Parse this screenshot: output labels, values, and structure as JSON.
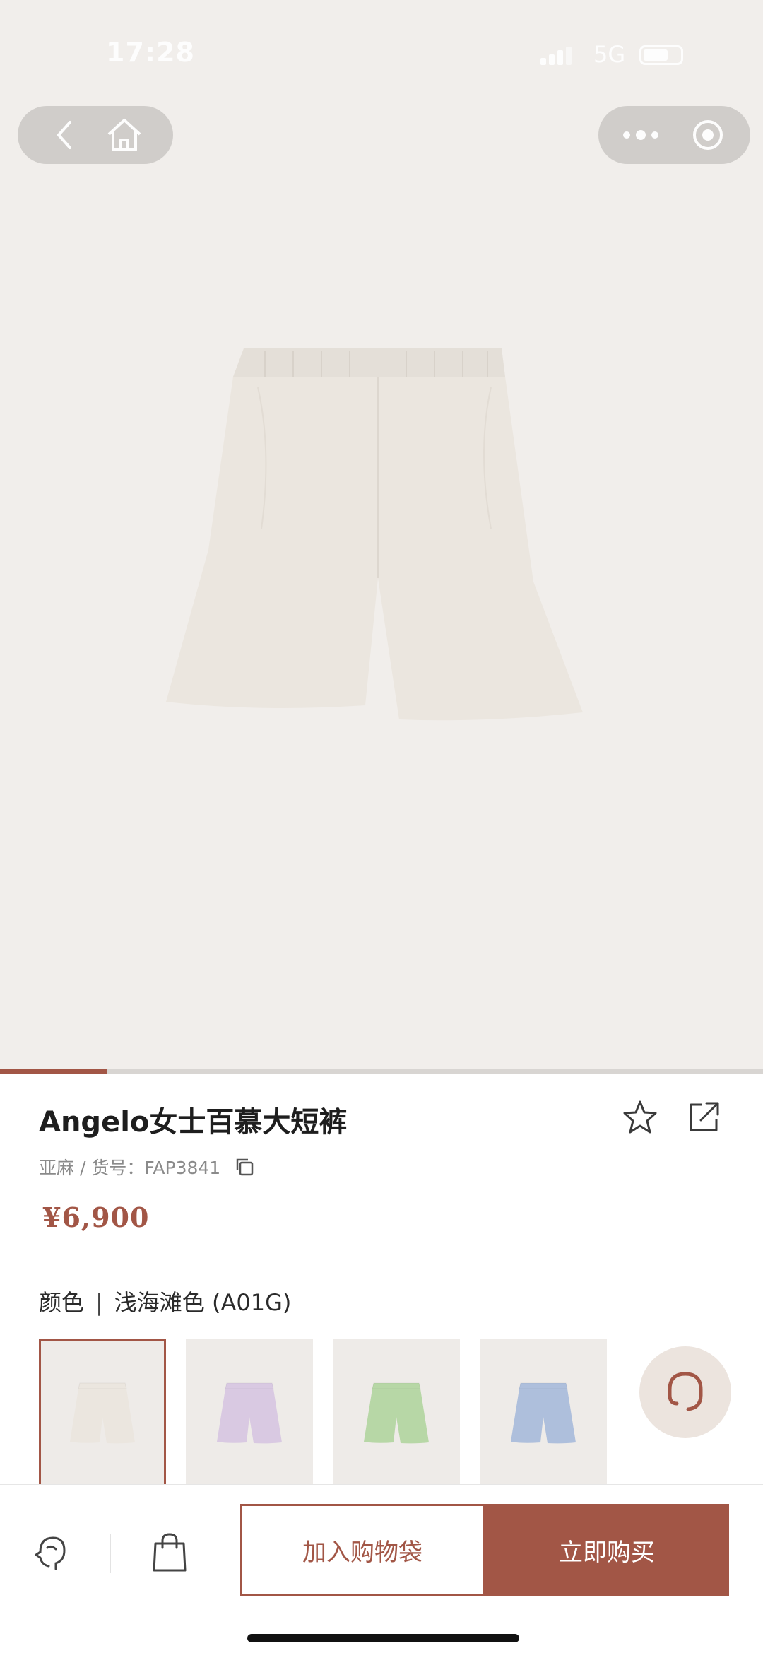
{
  "status_bar": {
    "time": "17:28",
    "network": "5G"
  },
  "product": {
    "title": "Angelo女士百慕大短裤",
    "material_sku": "亚麻 / 货号：FAP3841",
    "price": "¥6,900",
    "color_label": "颜色",
    "color_sep": "|",
    "color_value": "浅海滩色 (A01G)"
  },
  "gallery": {
    "progress": 0.14
  },
  "swatches": [
    {
      "name": "beige",
      "color": "#ebe6df",
      "selected": true
    },
    {
      "name": "lilac",
      "color": "#d9c9e2",
      "selected": false
    },
    {
      "name": "green",
      "color": "#b7d7a6",
      "selected": false
    },
    {
      "name": "blue",
      "color": "#aebfdc",
      "selected": false
    }
  ],
  "actions": {
    "add_to_bag": "加入购物袋",
    "buy_now": "立即购买"
  },
  "colors": {
    "accent": "#a25646",
    "hero_bg": "#f1eeeb"
  }
}
